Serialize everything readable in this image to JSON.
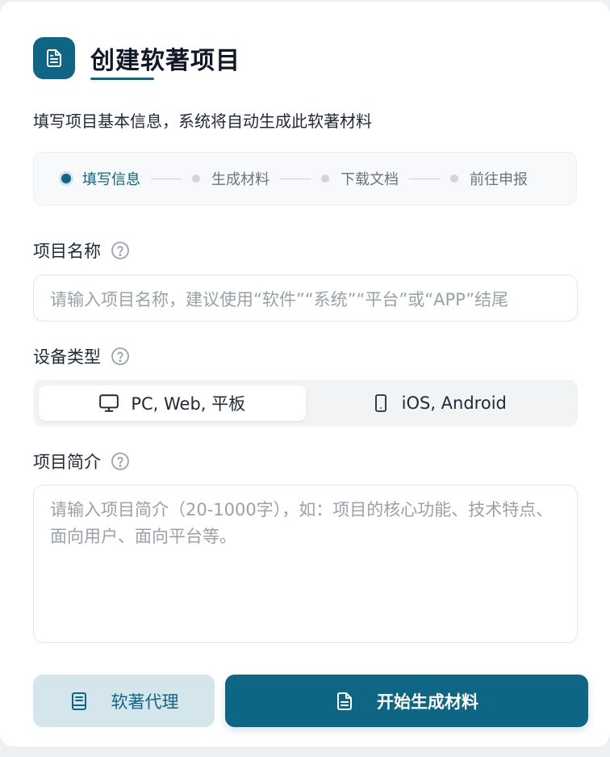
{
  "header": {
    "title": "创建软著项目"
  },
  "subtitle": "填写项目基本信息，系统将自动生成此软著材料",
  "steps": [
    {
      "label": "填写信息",
      "active": true
    },
    {
      "label": "生成材料",
      "active": false
    },
    {
      "label": "下载文档",
      "active": false
    },
    {
      "label": "前往申报",
      "active": false
    }
  ],
  "fields": {
    "name": {
      "label": "项目名称",
      "placeholder": "请输入项目名称，建议使用“软件”“系统”“平台”或“APP”结尾",
      "value": ""
    },
    "device": {
      "label": "设备类型",
      "options": [
        {
          "label": "PC, Web, 平板",
          "icon": "monitor-icon",
          "selected": true
        },
        {
          "label": "iOS, Android",
          "icon": "smartphone-icon",
          "selected": false
        }
      ]
    },
    "intro": {
      "label": "项目简介",
      "placeholder": "请输入项目简介（20-1000字），如：项目的核心功能、技术特点、面向用户、面向平台等。",
      "value": ""
    }
  },
  "buttons": {
    "agent": {
      "label": "软著代理",
      "icon": "book-icon"
    },
    "generate": {
      "label": "开始生成材料",
      "icon": "document-icon"
    }
  },
  "colors": {
    "primary": "#0e6584",
    "secondary_bg": "#d5e5ec"
  }
}
